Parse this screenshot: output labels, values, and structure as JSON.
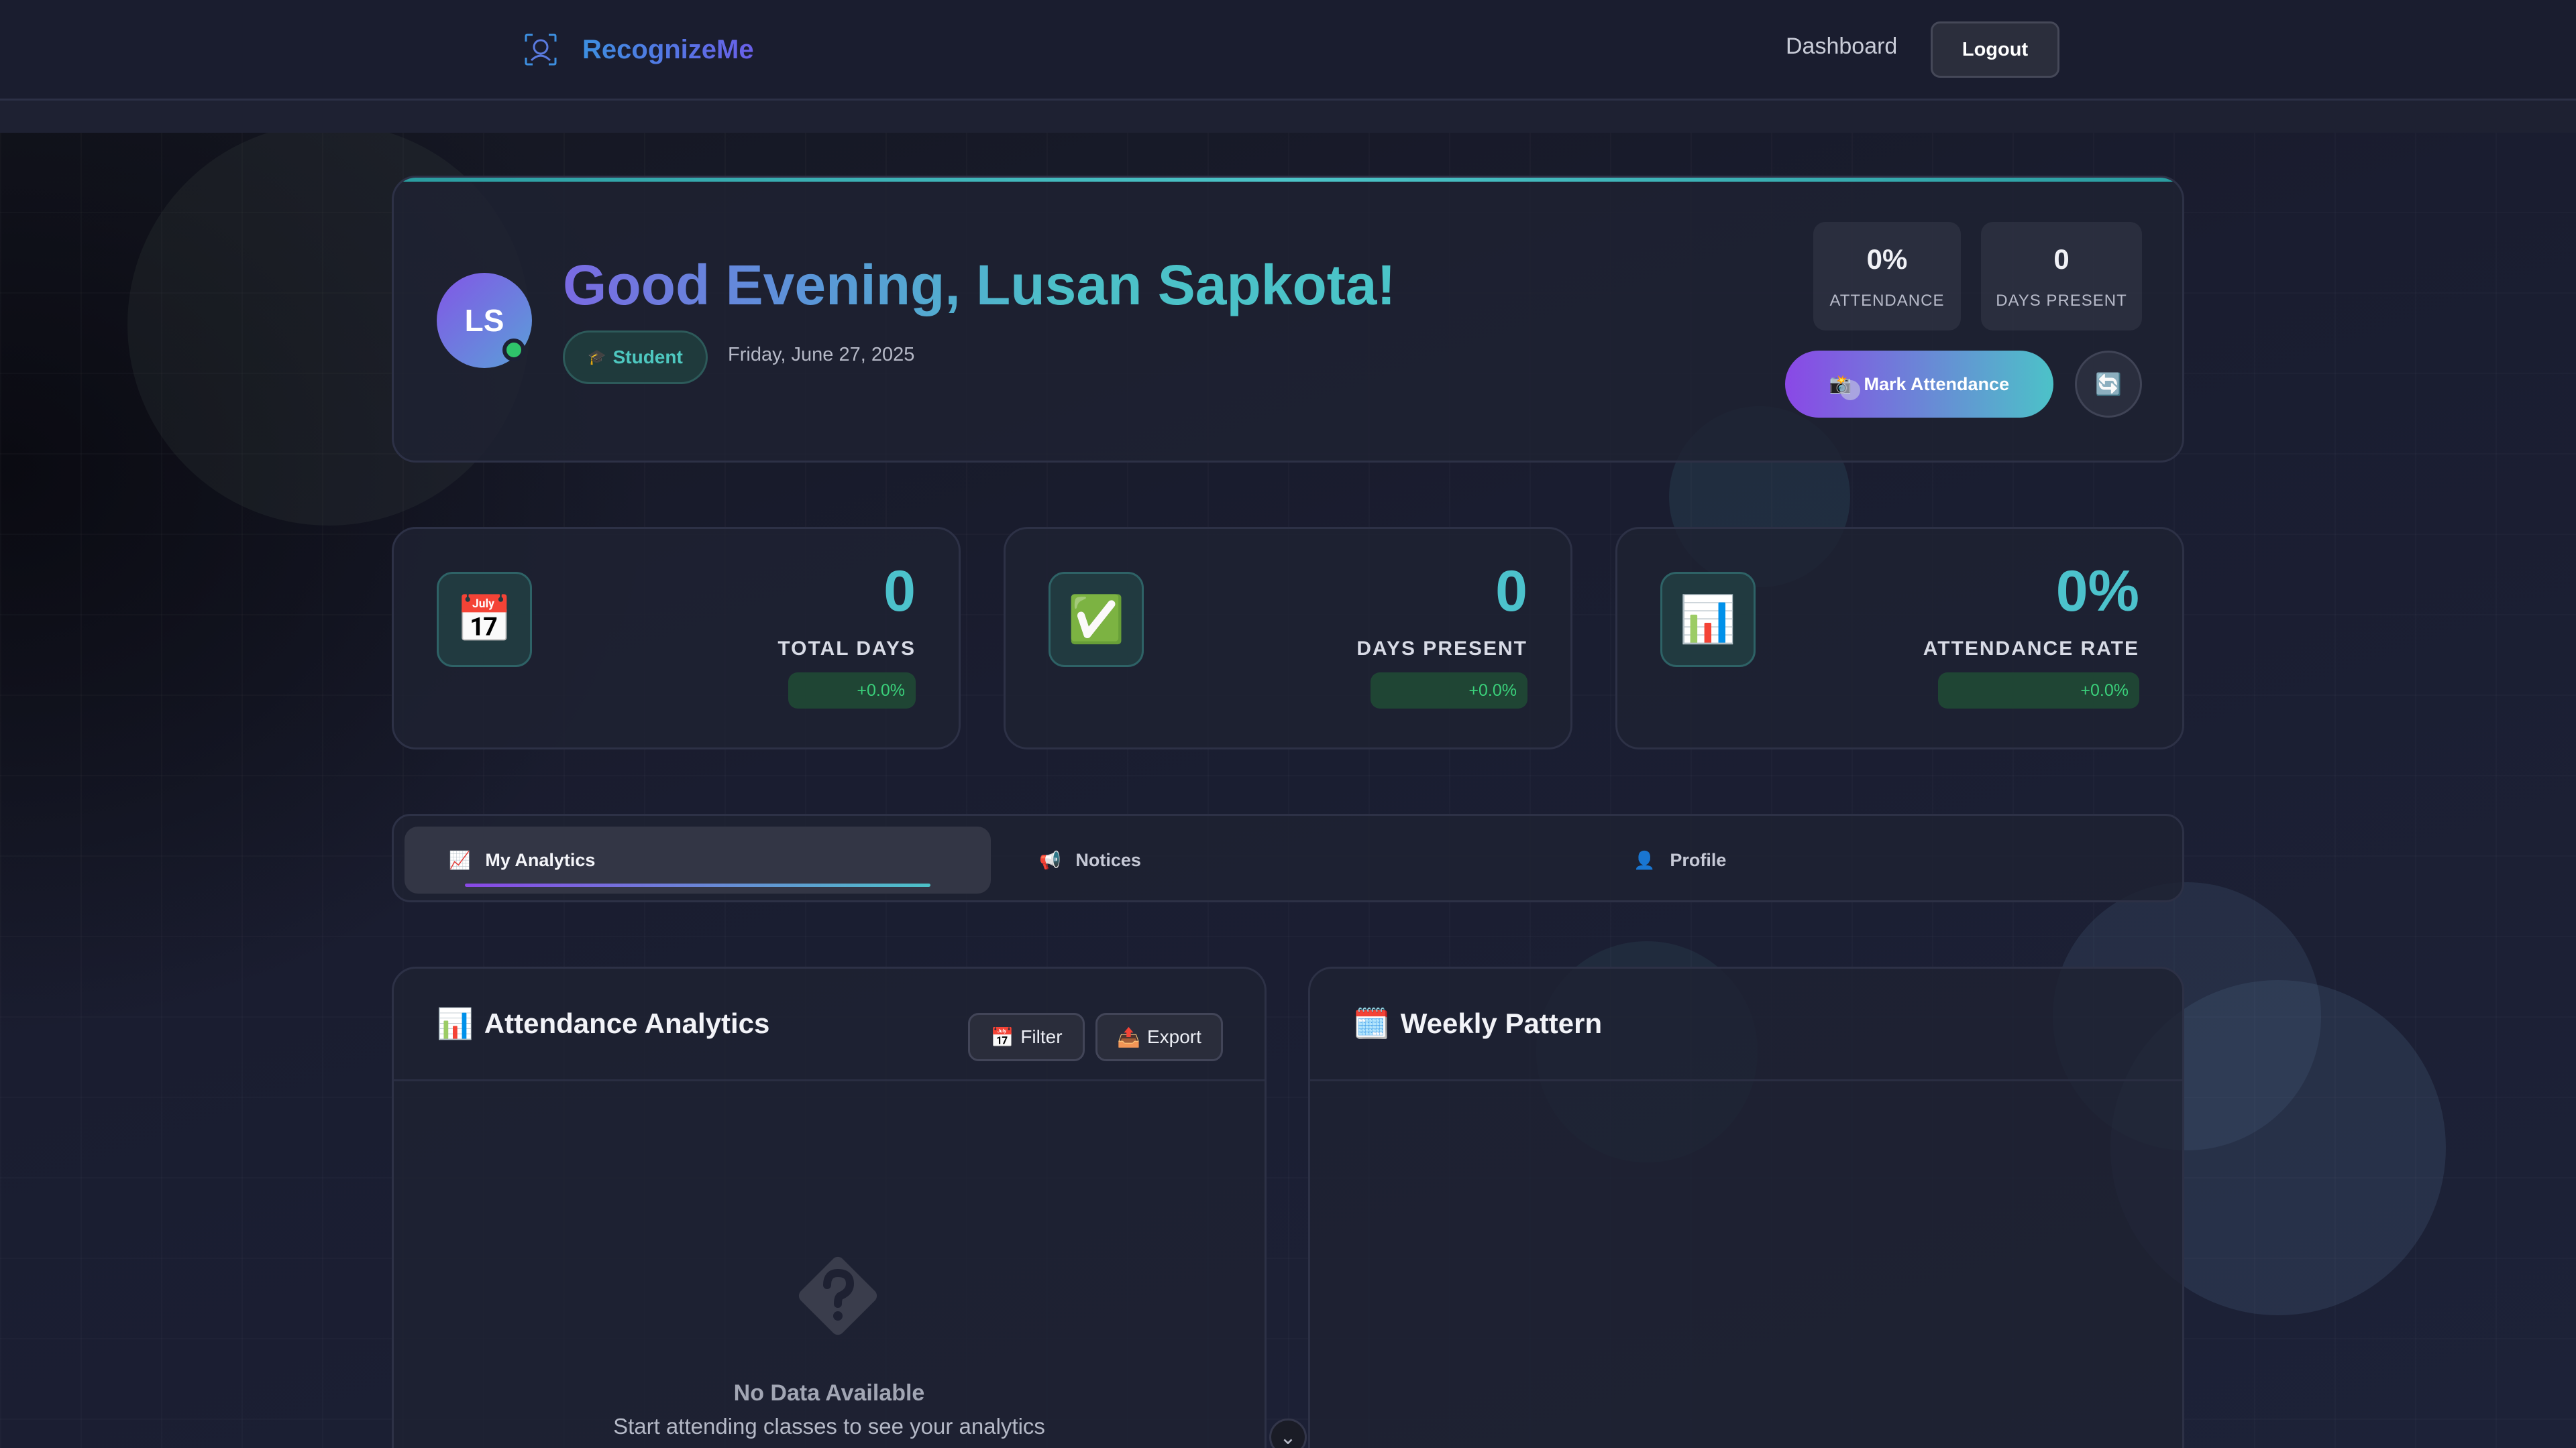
{
  "navbar": {
    "brand": "RecognizeMe",
    "brand_icon": "face-scan-icon",
    "dashboard_link": "Dashboard",
    "logout_label": "Logout"
  },
  "hero": {
    "avatar_initials": "LS",
    "greeting": "Good Evening, Lusan Sapkota!",
    "role_icon": "🎓",
    "role": "Student",
    "date": "Friday, June 27, 2025",
    "mini_stats": [
      {
        "value": "0%",
        "label": "ATTENDANCE"
      },
      {
        "value": "0",
        "label": "DAYS PRESENT"
      }
    ],
    "mark_attendance_icon": "📸",
    "mark_attendance_label": "Mark Attendance",
    "refresh_icon": "🔄"
  },
  "stats": [
    {
      "icon": "📅",
      "value": "0",
      "label": "TOTAL DAYS",
      "change": "+0.0%"
    },
    {
      "icon": "✅",
      "value": "0",
      "label": "DAYS PRESENT",
      "change": "+0.0%"
    },
    {
      "icon": "📊",
      "value": "0%",
      "label": "ATTENDANCE RATE",
      "change": "+0.0%"
    }
  ],
  "tabs": [
    {
      "icon": "📈",
      "label": "My Analytics",
      "active": true
    },
    {
      "icon": "📢",
      "label": "Notices",
      "active": false
    },
    {
      "icon": "👤",
      "label": "Profile",
      "active": false
    }
  ],
  "analytics_panel": {
    "icon": "📊",
    "title": "Attendance Analytics",
    "filter_icon": "📅",
    "filter_label": "Filter",
    "export_icon": "📤",
    "export_label": "Export",
    "empty_title": "No Data Available",
    "empty_subtitle": "Start attending classes to see your analytics"
  },
  "weekly_panel": {
    "icon": "🗓️",
    "title": "Weekly Pattern"
  },
  "colors": {
    "accent_teal": "#4cc2cc",
    "accent_purple": "#8a48e6",
    "success_green": "#3ad07a",
    "brand_blue": "#3d8fe0"
  }
}
